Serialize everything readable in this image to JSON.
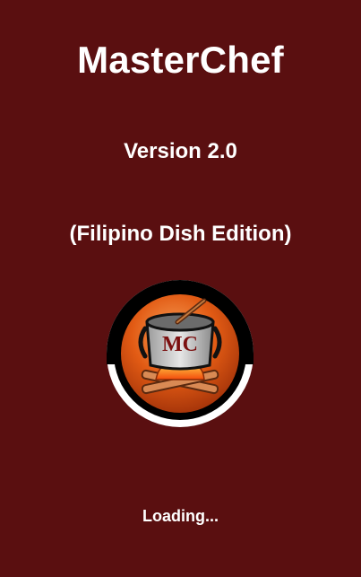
{
  "app": {
    "title": "MasterChef",
    "version": "Version 2.0",
    "edition": "(Filipino Dish Edition)",
    "loading_text": "Loading...",
    "logo": {
      "icon": "cooking-pot-fire-icon",
      "monogram": "MC"
    },
    "colors": {
      "background": "#5a0f10",
      "text": "#ffffff",
      "logo_orange": "#e25b14",
      "logo_ring": "#000000"
    }
  }
}
